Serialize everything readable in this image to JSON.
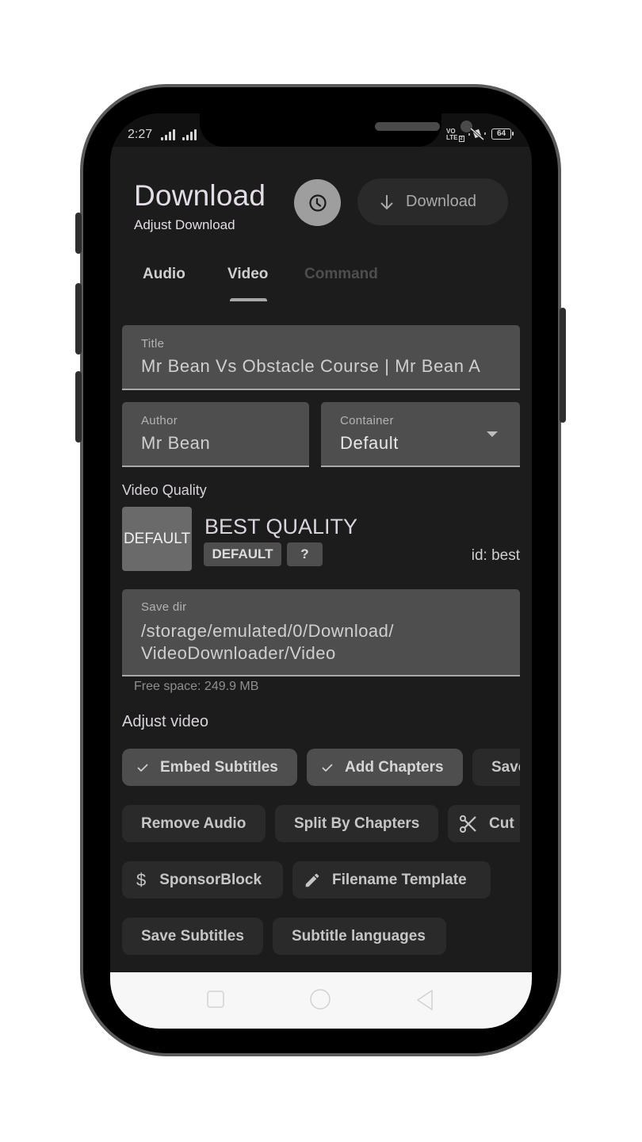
{
  "status_bar": {
    "time": "2:27",
    "network_label": "VO\nLTE2",
    "battery": "64"
  },
  "header": {
    "title": "Download",
    "subtitle": "Adjust Download",
    "history_icon": "clock-icon",
    "download_button": {
      "label": "Download",
      "icon": "arrow-down-icon"
    }
  },
  "tabs": [
    {
      "label": "Audio",
      "state": "normal"
    },
    {
      "label": "Video",
      "state": "selected"
    },
    {
      "label": "Command",
      "state": "disabled"
    }
  ],
  "fields": {
    "title": {
      "label": "Title",
      "value": "Mr Bean Vs Obstacle Course | Mr Bean A"
    },
    "author": {
      "label": "Author",
      "value": "Mr Bean"
    },
    "container": {
      "label": "Container",
      "value": "Default"
    }
  },
  "video_quality": {
    "section_label": "Video Quality",
    "thumbnail_text": "DEFAULT",
    "name": "BEST QUALITY",
    "badges": [
      "DEFAULT",
      "?"
    ],
    "id_text": "id: best"
  },
  "save_dir": {
    "label": "Save dir",
    "value_line1": "/storage/emulated/0/Download/",
    "value_line2": "VideoDownloader/Video",
    "free_space": "Free space: 249.9 MB"
  },
  "adjust_video": {
    "section_label": "Adjust video",
    "chips": [
      {
        "label": "Embed Subtitles",
        "selected": true,
        "icon": "check-icon"
      },
      {
        "label": "Add Chapters",
        "selected": true,
        "icon": "check-icon"
      },
      {
        "label": "Save",
        "selected": false,
        "icon": null
      },
      {
        "label": "Remove Audio",
        "selected": false,
        "icon": null
      },
      {
        "label": "Split By Chapters",
        "selected": false,
        "icon": null
      },
      {
        "label": "Cut",
        "selected": false,
        "icon": "scissors-icon"
      },
      {
        "label": "SponsorBlock",
        "selected": false,
        "icon": "dollar-icon"
      },
      {
        "label": "Filename Template",
        "selected": false,
        "icon": "pencil-icon"
      },
      {
        "label": "Save Subtitles",
        "selected": false,
        "icon": null
      },
      {
        "label": "Subtitle languages",
        "selected": false,
        "icon": null
      }
    ]
  },
  "nav_bar": {
    "buttons": [
      "recents",
      "home",
      "back"
    ]
  },
  "colors": {
    "background": "#1c1c1c",
    "field_fill": "#4e4e4e",
    "chip_fill": "#2a2a2a",
    "chip_selected_fill": "#4e4e4e",
    "history_button": "#9e9e9e",
    "navbar": "#f7f7f7"
  }
}
